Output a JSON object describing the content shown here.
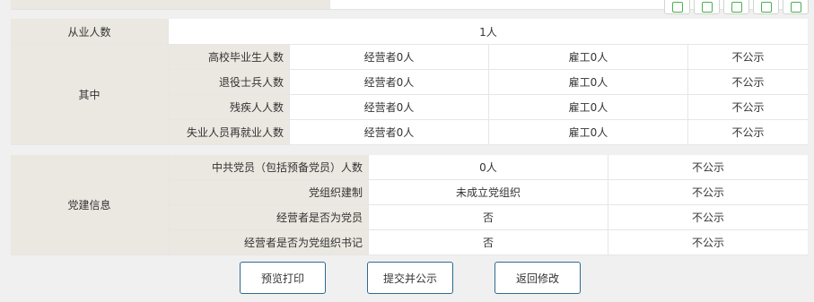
{
  "employees": {
    "label": "从业人数",
    "value": "1人"
  },
  "breakdown": {
    "group_label": "其中",
    "rows": [
      {
        "label": "高校毕业生人数",
        "operator": "经营者0人",
        "employee": "雇工0人",
        "status": "不公示"
      },
      {
        "label": "退役士兵人数",
        "operator": "经营者0人",
        "employee": "雇工0人",
        "status": "不公示"
      },
      {
        "label": "残疾人人数",
        "operator": "经营者0人",
        "employee": "雇工0人",
        "status": "不公示"
      },
      {
        "label": "失业人员再就业人数",
        "operator": "经营者0人",
        "employee": "雇工0人",
        "status": "不公示"
      }
    ]
  },
  "party": {
    "group_label": "党建信息",
    "rows": [
      {
        "label": "中共党员（包括预备党员）人数",
        "value": "0人",
        "status": "不公示"
      },
      {
        "label": "党组织建制",
        "value": "未成立党组织",
        "status": "不公示"
      },
      {
        "label": "经营者是否为党员",
        "value": "否",
        "status": "不公示"
      },
      {
        "label": "经营者是否为党组织书记",
        "value": "否",
        "status": "不公示"
      }
    ]
  },
  "actions": {
    "preview": "预览打印",
    "submit": "提交并公示",
    "back": "返回修改"
  },
  "toolbar": {
    "icons": [
      "print-icon",
      "fullscreen-icon",
      "save-icon",
      "window-icon",
      "settings-icon"
    ]
  },
  "colors": {
    "label_bg": "#ebe7e1",
    "button_border": "#2d6a8f",
    "toolbar_icon": "#4caf50"
  }
}
